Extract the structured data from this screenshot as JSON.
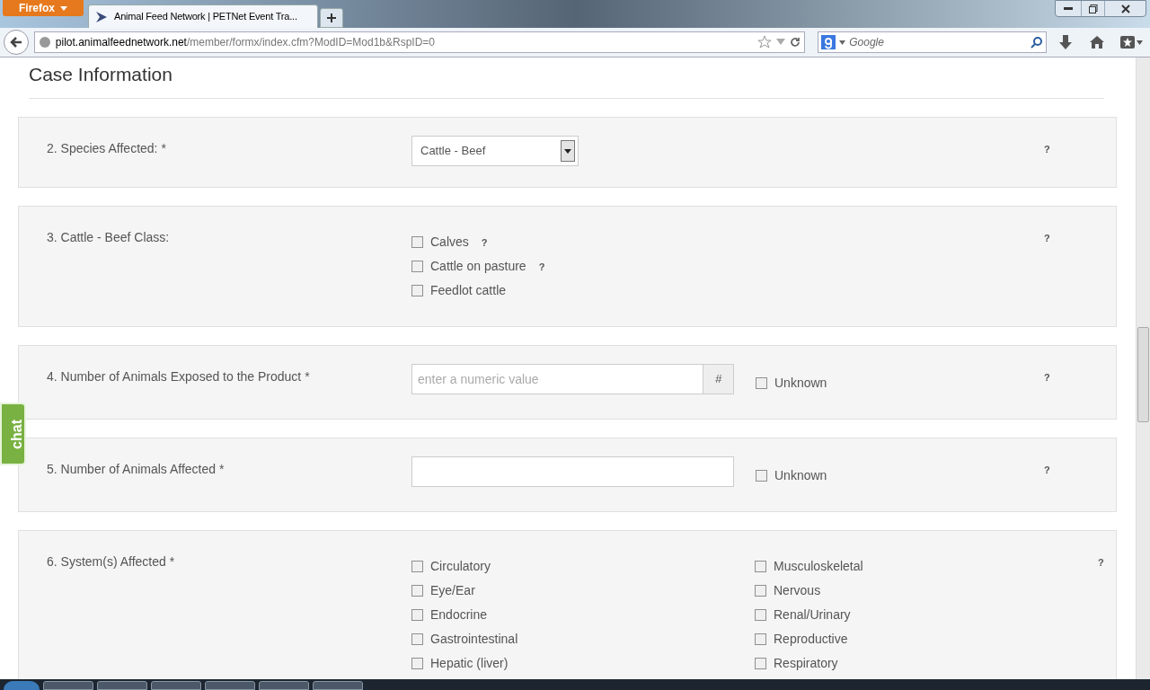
{
  "browser": {
    "menu_button": "Firefox",
    "tab_title": "Animal Feed Network | PETNet Event Tra...",
    "url_host": "pilot.animalfeednetwork.net",
    "url_path": "/member/formx/index.cfm?ModID=Mod1b&RspID=0",
    "search_placeholder": "Google"
  },
  "page": {
    "heading": "Case Information",
    "chat": "chat",
    "questions": [
      {
        "kind": "select",
        "label": "2. Species Affected: *",
        "value": "Cattle - Beef",
        "help": "?"
      },
      {
        "kind": "checklist",
        "label": "3. Cattle - Beef Class:",
        "help": "?",
        "options": [
          {
            "label": "Calves",
            "checked": false,
            "help": "?"
          },
          {
            "label": "Cattle on pasture",
            "checked": false,
            "help": "?"
          },
          {
            "label": "Feedlot cattle",
            "checked": false
          }
        ]
      },
      {
        "kind": "number",
        "label": "4. Number of Animals Exposed to the Product *",
        "placeholder": "enter a numeric value",
        "addon": "#",
        "unknown": {
          "label": "Unknown",
          "checked": false
        },
        "help": "?"
      },
      {
        "kind": "text",
        "label": "5. Number of Animals Affected *",
        "unknown": {
          "label": "Unknown",
          "checked": false
        },
        "help": "?"
      },
      {
        "kind": "twocol",
        "label": "6. System(s) Affected *",
        "help": "?",
        "columns": [
          [
            {
              "label": "Circulatory",
              "checked": false
            },
            {
              "label": "Eye/Ear",
              "checked": false
            },
            {
              "label": "Endocrine",
              "checked": false
            },
            {
              "label": "Gastrointestinal",
              "checked": false
            },
            {
              "label": "Hepatic (liver)",
              "checked": false
            }
          ],
          [
            {
              "label": "Musculoskeletal",
              "checked": false
            },
            {
              "label": "Nervous",
              "checked": false
            },
            {
              "label": "Renal/Urinary",
              "checked": false
            },
            {
              "label": "Reproductive",
              "checked": false
            },
            {
              "label": "Respiratory",
              "checked": false
            }
          ]
        ]
      }
    ]
  }
}
